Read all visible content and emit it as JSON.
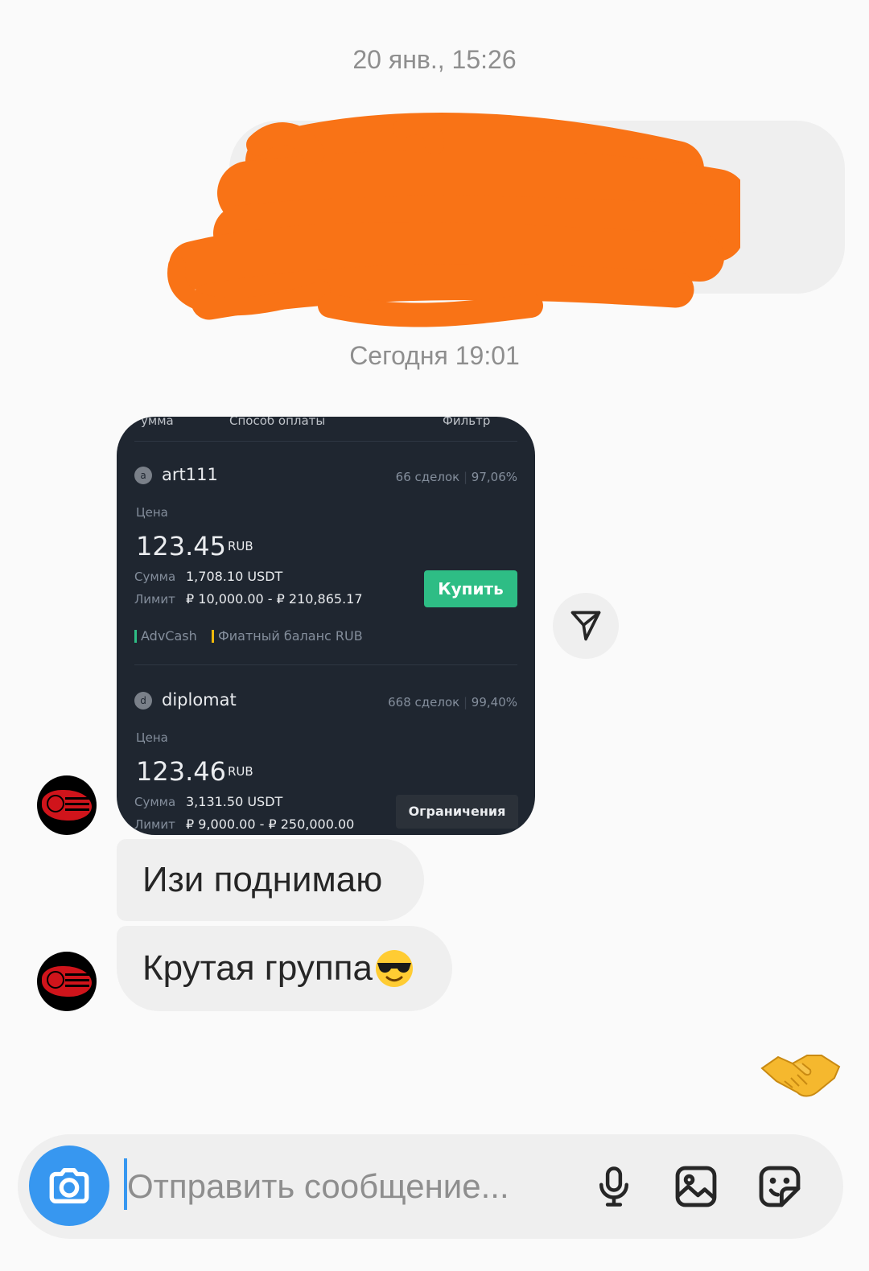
{
  "thread": {
    "timestamp_1": "20 янв., 15:26",
    "timestamp_2": "Сегодня 19:01"
  },
  "shared_screenshot": {
    "header": {
      "amount": "умма",
      "payment_method": "Способ оплаты",
      "filter": "Фильтр"
    },
    "offers": [
      {
        "avatar_letter": "a",
        "trader": "art111",
        "deals": "66 сделок",
        "completion": "97,06%",
        "price_label": "Цена",
        "price": "123.45",
        "currency": "RUB",
        "amount_label": "Сумма",
        "amount": "1,708.10 USDT",
        "limit_label": "Лимит",
        "limit": "₽ 10,000.00 - ₽ 210,865.17",
        "action": "Купить",
        "payment_methods": [
          "AdvCash",
          "Фиатный баланс RUB"
        ]
      },
      {
        "avatar_letter": "d",
        "trader": "diplomat",
        "deals": "668 сделок",
        "completion": "99,40%",
        "price_label": "Цена",
        "price": "123.46",
        "currency": "RUB",
        "amount_label": "Сумма",
        "amount": "3,131.50 USDT",
        "limit_label": "Лимит",
        "limit": "₽ 9,000.00 - ₽ 250,000.00",
        "action": "Ограничения >>"
      }
    ]
  },
  "messages": [
    {
      "text": "Изи поднимаю"
    },
    {
      "text": "Крутая группа"
    }
  ],
  "icons": {
    "share": "paper-plane-icon",
    "emoji_in_message": "sunglasses-emoji",
    "sent_reaction": "handshake-emoji",
    "camera": "camera-icon",
    "mic": "microphone-icon",
    "gallery": "image-icon",
    "sticker": "sticker-icon"
  },
  "composer": {
    "placeholder": "Отправить сообщение..."
  },
  "colors": {
    "accent": "#3797f0",
    "redaction": "#f97316",
    "buy_green": "#2ebd85",
    "bubble": "#efefef"
  }
}
